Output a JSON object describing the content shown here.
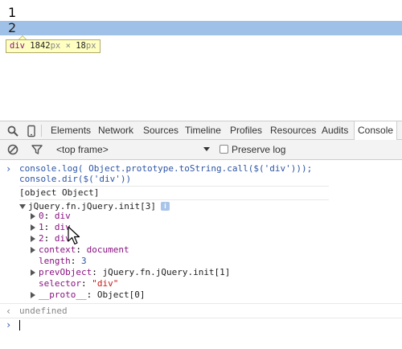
{
  "page": {
    "line1": "1",
    "line2": "2",
    "tooltip": {
      "tag": "div",
      "width": "1842",
      "height": "18",
      "unit": "px",
      "times": "×"
    }
  },
  "devtools": {
    "tabs": [
      "Elements",
      "Network",
      "Sources",
      "Timeline",
      "Profiles",
      "Resources",
      "Audits",
      "Console"
    ],
    "active_tab": "Console",
    "filter": {
      "frame_select": "<top frame>",
      "preserve_log_label": "Preserve log"
    },
    "console": {
      "input_line1": "console.log( Object.prototype.toString.call($('div')));",
      "input_line2": "console.dir($('div'))",
      "log_output": "[object Object]",
      "dir_root": "jQuery.fn.jQuery.init[3]",
      "info_badge": "i",
      "entries": [
        {
          "key": "0",
          "sep": ": ",
          "value": "div"
        },
        {
          "key": "1",
          "sep": ": ",
          "value": "div"
        },
        {
          "key": "2",
          "sep": ": ",
          "value": "div"
        },
        {
          "key": "context",
          "sep": ": ",
          "value": "document"
        },
        {
          "key": "length",
          "sep": ": ",
          "value": "3"
        },
        {
          "key": "prevObject",
          "sep": ": ",
          "value": "jQuery.fn.jQuery.init[1]"
        },
        {
          "key": "selector",
          "sep": ": ",
          "value": "\"div\""
        },
        {
          "key": "__proto__",
          "sep": ": ",
          "value": "Object[0]"
        }
      ],
      "return_value": "undefined"
    }
  },
  "colors": {
    "highlight": "#9fc1e7",
    "prompt_blue": "#2d55a5",
    "key_purple": "#881280",
    "string_red": "#c41a16"
  }
}
